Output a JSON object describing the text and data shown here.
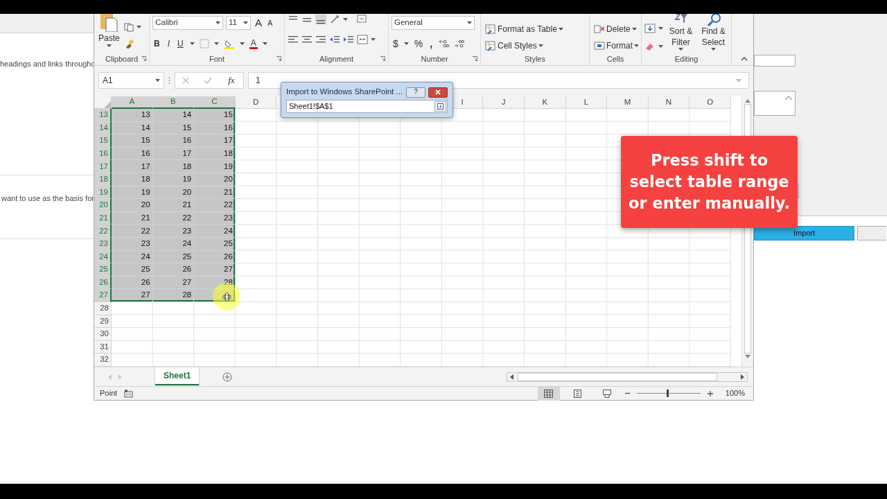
{
  "background_page": {
    "left_texts": [
      "headings and links througho",
      "want to use as the basis for"
    ],
    "import_button": "Import"
  },
  "excel": {
    "ribbon": {
      "groups": [
        {
          "kind": "clipboard",
          "label": "Clipboard",
          "paste": "Paste"
        },
        {
          "kind": "font",
          "label": "Font",
          "font_name": "Calibri",
          "font_size": "11",
          "grow": "A",
          "shrink": "A",
          "bold": "B",
          "italic": "I",
          "underline": "U",
          "font_color": "A"
        },
        {
          "kind": "alignment",
          "label": "Alignment"
        },
        {
          "kind": "number",
          "label": "Number",
          "format": "General",
          "currency": "$",
          "percent": "%",
          "comma": ","
        },
        {
          "kind": "styles",
          "label": "Styles",
          "buttons": [
            "Format as Table",
            "Cell Styles"
          ]
        },
        {
          "kind": "cells",
          "label": "Cells",
          "buttons": [
            "Delete",
            "Format"
          ]
        },
        {
          "kind": "editing",
          "label": "Editing",
          "buttons": [
            "Sort & Filter",
            "Find & Select"
          ]
        }
      ]
    },
    "name_box": "A1",
    "fx": "fx",
    "formula": "1",
    "columns": [
      {
        "kind": "header",
        "label": "A",
        "selected": true
      },
      {
        "kind": "header",
        "label": "B",
        "selected": true
      },
      {
        "kind": "header",
        "label": "C",
        "selected": true
      },
      {
        "kind": "header",
        "label": "D",
        "selected": false
      },
      {
        "kind": "covered"
      },
      {
        "kind": "covered"
      },
      {
        "kind": "covered"
      },
      {
        "kind": "covered"
      },
      {
        "kind": "header",
        "label": "I",
        "selected": false
      },
      {
        "kind": "header",
        "label": "J",
        "selected": false
      },
      {
        "kind": "header",
        "label": "K",
        "selected": false
      },
      {
        "kind": "header",
        "label": "L",
        "selected": false
      },
      {
        "kind": "header",
        "label": "M",
        "selected": false
      },
      {
        "kind": "header",
        "label": "N",
        "selected": false
      },
      {
        "kind": "header",
        "label": "O",
        "selected": false
      }
    ],
    "rows": [
      {
        "header": "13",
        "selected": true,
        "cells": [
          "13",
          "14",
          "15"
        ]
      },
      {
        "header": "14",
        "selected": true,
        "cells": [
          "14",
          "15",
          "16"
        ]
      },
      {
        "header": "15",
        "selected": true,
        "cells": [
          "15",
          "16",
          "17"
        ]
      },
      {
        "header": "16",
        "selected": true,
        "cells": [
          "16",
          "17",
          "18"
        ]
      },
      {
        "header": "17",
        "selected": true,
        "cells": [
          "17",
          "18",
          "19"
        ]
      },
      {
        "header": "18",
        "selected": true,
        "cells": [
          "18",
          "19",
          "20"
        ]
      },
      {
        "header": "19",
        "selected": true,
        "cells": [
          "19",
          "20",
          "21"
        ]
      },
      {
        "header": "20",
        "selected": true,
        "cells": [
          "20",
          "21",
          "22"
        ]
      },
      {
        "header": "21",
        "selected": true,
        "cells": [
          "21",
          "22",
          "23"
        ]
      },
      {
        "header": "22",
        "selected": true,
        "cells": [
          "22",
          "23",
          "24"
        ]
      },
      {
        "header": "23",
        "selected": true,
        "cells": [
          "23",
          "24",
          "25"
        ]
      },
      {
        "header": "24",
        "selected": true,
        "cells": [
          "24",
          "25",
          "26"
        ]
      },
      {
        "header": "25",
        "selected": true,
        "cells": [
          "25",
          "26",
          "27"
        ]
      },
      {
        "header": "26",
        "selected": true,
        "cells": [
          "26",
          "27",
          "28"
        ]
      },
      {
        "header": "27",
        "selected": true,
        "cells": [
          "27",
          "28"
        ]
      },
      {
        "header": "28",
        "selected": false,
        "cells": []
      },
      {
        "header": "29",
        "selected": false,
        "cells": []
      },
      {
        "header": "30",
        "selected": false,
        "cells": []
      },
      {
        "header": "31",
        "selected": false,
        "cells": []
      },
      {
        "header": "32",
        "selected": false,
        "cells": []
      }
    ],
    "sheet_tabs": [
      {
        "label": "Sheet1",
        "selected": true
      }
    ],
    "status": "Point",
    "zoom": {
      "level": 0.47,
      "reading": "100%"
    }
  },
  "dialog": {
    "title": "Import to Windows SharePoint ...",
    "help": "?",
    "range": "Sheet1!$A$1"
  },
  "callout": "Press shift to select table range or enter manually."
}
